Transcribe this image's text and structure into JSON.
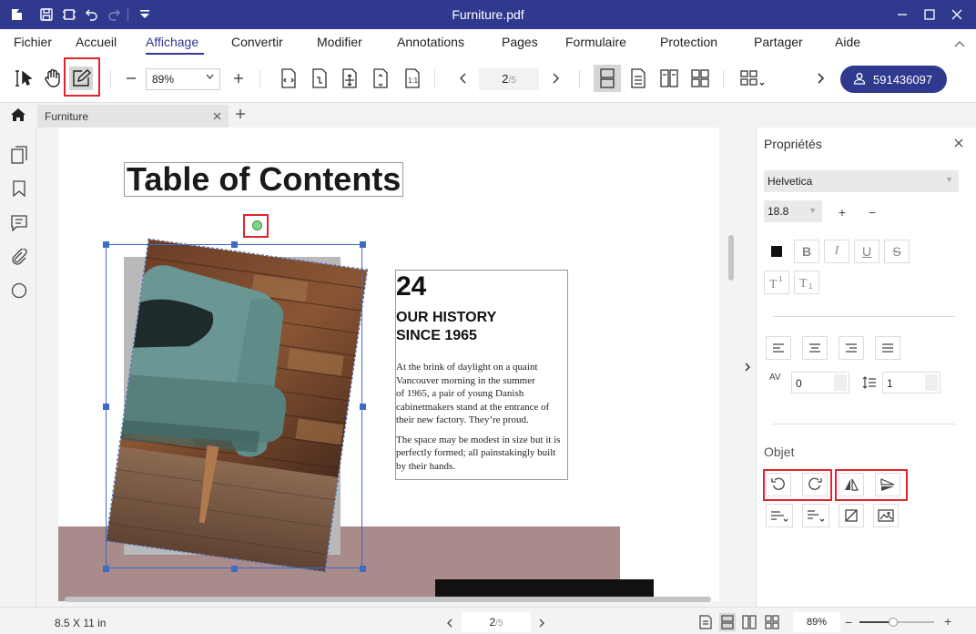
{
  "window": {
    "title": "Furniture.pdf"
  },
  "menu": {
    "items": [
      "Fichier",
      "Accueil",
      "Affichage",
      "Convertir",
      "Modifier",
      "Annotations",
      "Pages",
      "Formulaire",
      "Protection",
      "Partager",
      "Aide"
    ],
    "active": "Affichage"
  },
  "toolbar": {
    "zoom": "89%",
    "page_current": "2",
    "page_total": "/5",
    "user_id": "591436097",
    "icons": [
      "select-icon",
      "hand-icon",
      "edit-icon",
      "zoom-out-icon",
      "zoom-in-icon",
      "fit-width-icon",
      "fit-page-icon",
      "actual-size-icon",
      "page-height-icon",
      "one-to-one-icon",
      "prev-page-icon",
      "next-page-icon",
      "single-page-icon",
      "continuous-icon",
      "two-page-icon",
      "two-page-continuous-icon",
      "grid-icon",
      "expand-icon",
      "user-icon"
    ]
  },
  "tabs": {
    "doc_tab": "Furniture",
    "add_icon": "plus-icon"
  },
  "document": {
    "title": "Table of Contents",
    "number": "24",
    "heading_line1": "OUR HISTORY",
    "heading_line2": "SINCE 1965",
    "para1_lines": [
      "At the brink of daylight on a quaint",
      "Vancouver morning in the summer",
      "of 1965, a pair of young Danish",
      "cabinetmakers stand at the entrance of",
      "their new factory. They’re proud."
    ],
    "para2_lines": [
      "The space may be modest in size but it is",
      "perfectly formed; all painstakingly built",
      "by their hands."
    ]
  },
  "panel": {
    "title": "Propriétés",
    "font": "Helvetica",
    "font_size": "18.8",
    "char_spacing": "0",
    "line_spacing": "1",
    "object_label": "Objet",
    "char_spacing_icon": "AV",
    "style_buttons": [
      "B",
      "I",
      "U",
      "S"
    ]
  },
  "status": {
    "page_size": "8.5 X 11 in",
    "page_current": "2",
    "page_total": "/5",
    "zoom": "89%",
    "zoom_fraction": 0.45
  },
  "colors": {
    "brand": "#2f3a8f",
    "highlight": "#e0242d",
    "selection": "#3d6cc4"
  }
}
